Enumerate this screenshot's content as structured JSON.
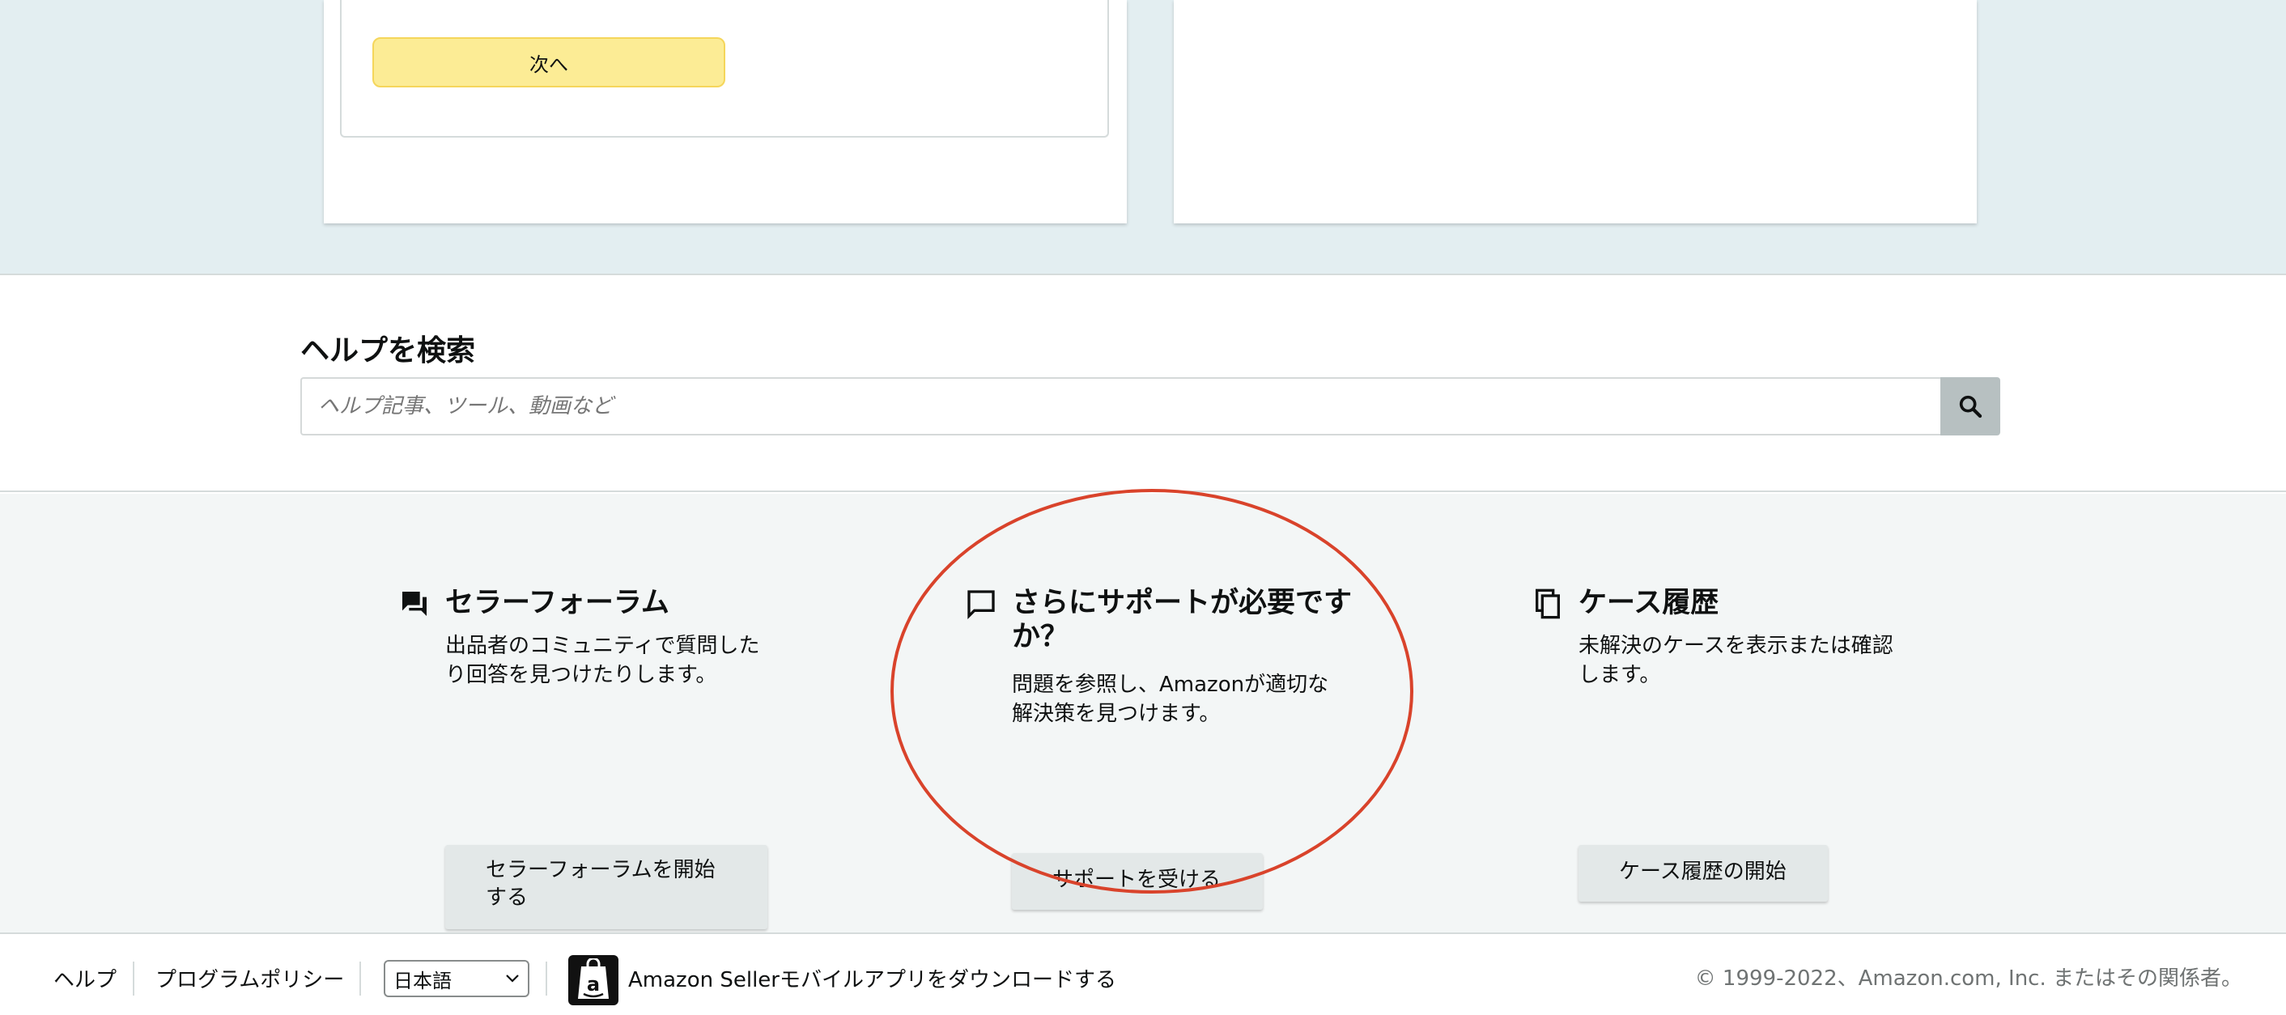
{
  "form": {
    "next_label": "次へ"
  },
  "help_search": {
    "title": "ヘルプを検索",
    "placeholder": "ヘルプ記事、ツール、動画など",
    "value": ""
  },
  "options": [
    {
      "title": "セラーフォーラム",
      "description": "出品者のコミュニティで質問したり回答を見つけたりします。",
      "button": "セラーフォーラムを開始する",
      "icon": "forum-icon"
    },
    {
      "title": "さらにサポートが必要ですか？",
      "description": "問題を参照し、Amazonが適切な解決策を見つけます。",
      "button": "サポートを受ける",
      "icon": "chat-bubble-icon"
    },
    {
      "title": "ケース履歴",
      "description": "未解決のケースを表示または確認します。",
      "button": "ケース履歴の開始",
      "icon": "copy-icon"
    }
  ],
  "footer": {
    "help": "ヘルプ",
    "program_policy": "プログラムポリシー",
    "language": "日本語",
    "app_download": "Amazon Sellerモバイルアプリをダウンロードする",
    "copyright": "© 1999-2022、Amazon.com, Inc. またはその関係者。"
  },
  "colors": {
    "next_button": "#fcec95",
    "top_band": "#e3eef1",
    "options_band": "#f3f6f6",
    "search_button": "#b7c0c1",
    "highlight": "#d9432b"
  }
}
